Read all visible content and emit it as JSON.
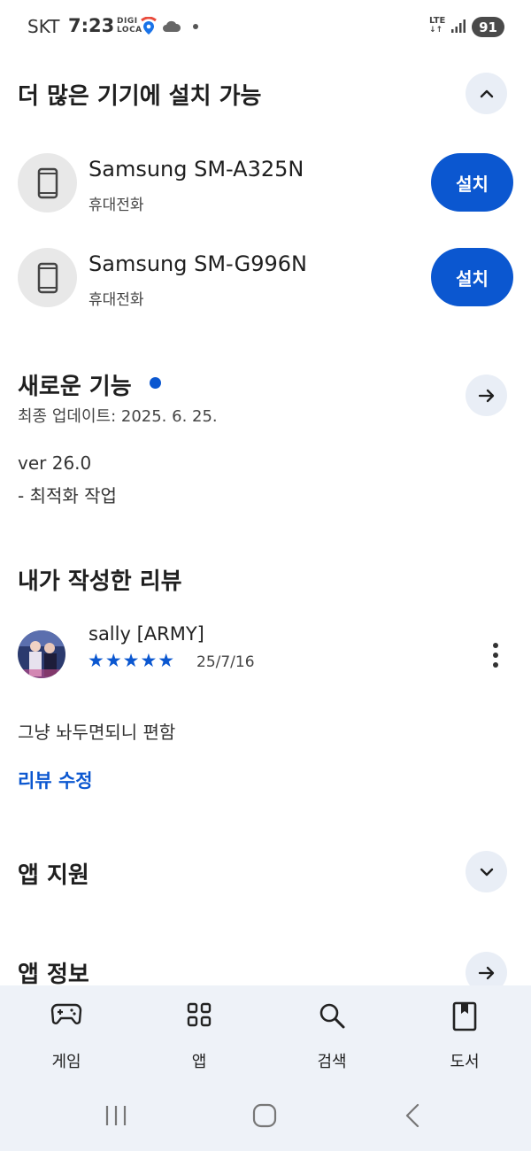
{
  "status_bar": {
    "carrier": "SKT",
    "time": "7:23",
    "digi_line1": "DIGI",
    "digi_line2": "LOCA",
    "lte": "LTE",
    "battery": "91"
  },
  "install_section": {
    "title": "더 많은 기기에 설치 가능",
    "devices": [
      {
        "name": "Samsung SM-A325N",
        "type": "휴대전화",
        "button": "설치"
      },
      {
        "name": "Samsung SM-G996N",
        "type": "휴대전화",
        "button": "설치"
      }
    ]
  },
  "whats_new": {
    "title": "새로운 기능",
    "updated": "최종 업데이트: 2025. 6. 25.",
    "version": "ver 26.0",
    "notes": "- 최적화 작업"
  },
  "my_review": {
    "title": "내가 작성한 리뷰",
    "reviewer": "sally [ARMY]",
    "rating": 5,
    "stars": "★★★★★",
    "date": "25/7/16",
    "text": "그냥 놔두면되니 편함",
    "edit_label": "리뷰 수정"
  },
  "app_support": {
    "title": "앱 지원"
  },
  "app_info": {
    "title": "앱 정보"
  },
  "bottom_nav": {
    "items": [
      {
        "label": "게임",
        "icon": "gamepad-icon"
      },
      {
        "label": "앱",
        "icon": "apps-grid-icon"
      },
      {
        "label": "검색",
        "icon": "search-icon"
      },
      {
        "label": "도서",
        "icon": "book-icon"
      }
    ]
  },
  "colors": {
    "accent": "#0b57d0",
    "circle_button_bg": "#e9eef6",
    "nav_bg": "#eef2f8"
  }
}
